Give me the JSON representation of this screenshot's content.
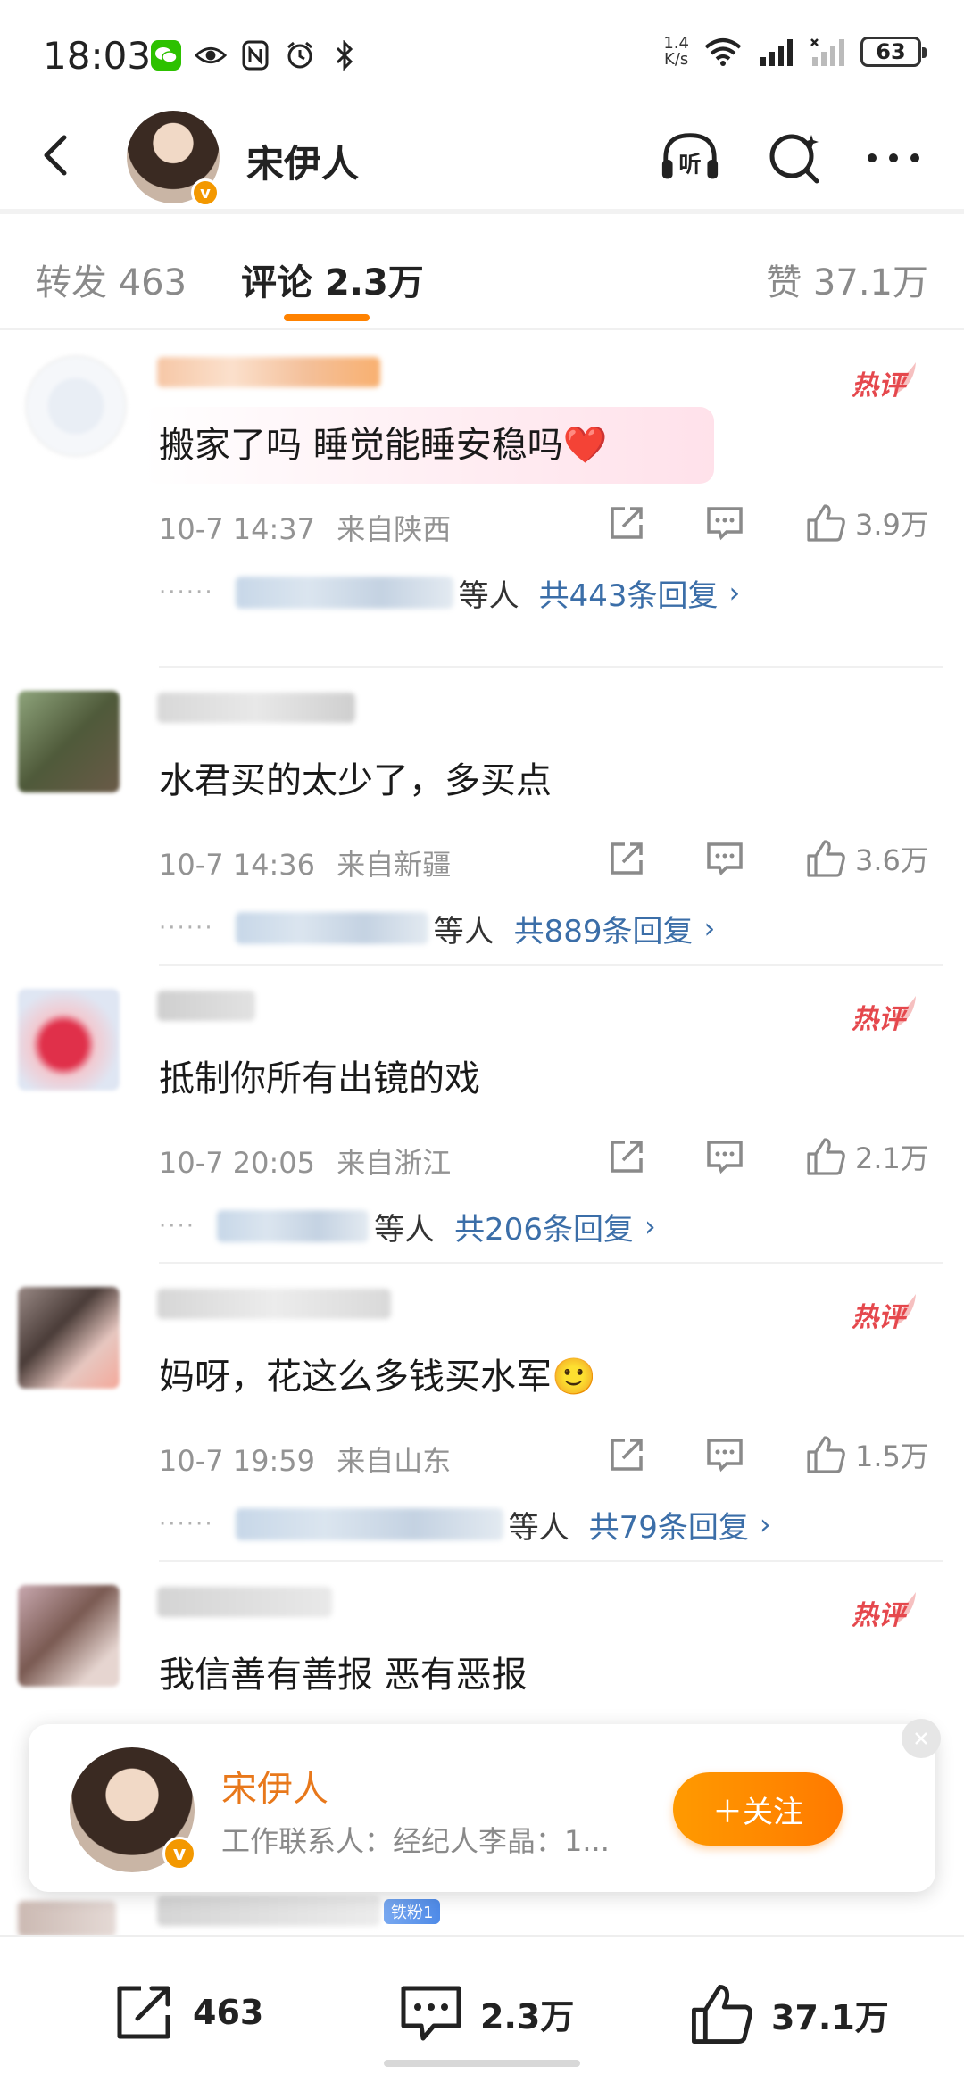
{
  "status_bar": {
    "time": "18:03",
    "net_speed_value": "1.4",
    "net_speed_unit": "K/s",
    "battery": "63",
    "icons": [
      "wechat-icon",
      "eye-icon",
      "nfc-icon",
      "alarm-icon",
      "bluetooth-icon",
      "wifi-icon",
      "signal-icon",
      "signal-2-icon",
      "battery-icon"
    ]
  },
  "header": {
    "name": "宋伊人",
    "verified_badge": "v",
    "icons": [
      "back-icon",
      "listen-icon",
      "search-icon",
      "more-icon"
    ],
    "listen_label": "听"
  },
  "tabs": {
    "repost": "转发 463",
    "comments": "评论 2.3万",
    "likes": "赞 37.1万"
  },
  "comments": [
    {
      "text": "搬家了吗 睡觉能睡安稳吗❤️",
      "time": "10-7 14:37",
      "location": "来自陕西",
      "likes": "3.9万",
      "reply_etc": "等人",
      "reply_total": "共443条回复",
      "hot": true
    },
    {
      "text": "水君买的太少了，多买点",
      "time": "10-7 14:36",
      "location": "来自新疆",
      "likes": "3.6万",
      "reply_etc": "等人",
      "reply_total": "共889条回复",
      "hot": false
    },
    {
      "text": "抵制你所有出镜的戏",
      "time": "10-7 20:05",
      "location": "来自浙江",
      "likes": "2.1万",
      "reply_etc": "等人",
      "reply_total": "共206条回复",
      "hot": true
    },
    {
      "text": "妈呀，花这么多钱买水军🙂",
      "time": "10-7 19:59",
      "location": "来自山东",
      "likes": "1.5万",
      "reply_etc": "等人",
      "reply_total": "共79条回复",
      "hot": true
    },
    {
      "text": "我信善有善报 恶有恶报",
      "hot": true
    }
  ],
  "hot_label": "热评",
  "follow_card": {
    "name": "宋伊人",
    "desc": "工作联系人：经纪人李晶：1...",
    "follow_label": "＋关注"
  },
  "partial_comment": {
    "fan_badge": "铁粉1"
  },
  "bottom_bar": {
    "reposts": "463",
    "comments": "2.3万",
    "likes": "37.1万"
  },
  "colors": {
    "accent": "#ff8200",
    "link": "#3b6ea8",
    "hot": "#e5484d"
  }
}
